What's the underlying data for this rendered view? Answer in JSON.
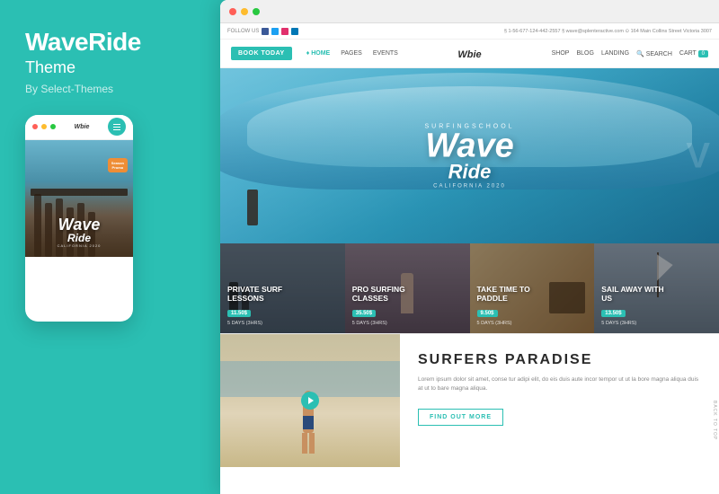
{
  "brand": {
    "title": "WaveRide",
    "subtitle": "Theme",
    "by": "By Select-Themes"
  },
  "mobile": {
    "dot_colors": [
      "#ff5f57",
      "#febc2e",
      "#28c840"
    ],
    "logo": "Wbie",
    "wave_text": "Wave",
    "ride_text": "Ride",
    "sub_text": "CALIFORNIA 2020",
    "badges": [
      "Season\nPromo"
    ]
  },
  "browser": {
    "dot_colors": [
      "#ff5f57",
      "#febc2e",
      "#28c840"
    ]
  },
  "site": {
    "topbar": {
      "follow_label": "FOLLOW US",
      "contact": "§ 1-56-677-124-442-2557  § wave@splenteractive.com  ⊙ 164 Main Collins Street Victoria 3007"
    },
    "nav": {
      "book_button": "BOOK TODAY",
      "links": [
        "♦ HOME",
        "PAGES",
        "EVENTS"
      ],
      "logo": "Wbie",
      "right_links": [
        "SHOP",
        "BLOG",
        "LANDING"
      ],
      "search": "SEARCH",
      "cart": "CART (0)",
      "cart_badge": "0"
    },
    "hero": {
      "school_text": "SURFINGSCHOOL",
      "wave_text": "Wave",
      "ride_text": "Ride",
      "california": "CALIFORNIA 2020"
    },
    "cards": [
      {
        "title": "PRIVATE SURF\nLESSONS",
        "badge": "11.50$",
        "days": "5 DAYS (3HRS)",
        "bg": "surf"
      },
      {
        "title": "PRO SURFING\nCLASSES",
        "badge": "35.50$",
        "days": "5 DAYS (3HRS)",
        "bg": "pro"
      },
      {
        "title": "TAKE TIME TO\nPADDLE",
        "badge": "9.50$",
        "days": "5 DAYS (3HRS)",
        "bg": "paddle"
      },
      {
        "title": "SAIL AWAY WITH\nUS",
        "badge": "13.50$",
        "days": "5 DAYS (3HRS)",
        "bg": "sail"
      }
    ],
    "lower": {
      "title": "SURFERS PARADISE",
      "text": "Lorem ipsum dolor sit amet, conse tur adipi elit, do eis duis aute incor tempor ut ut la bore magna aliqua duis at ut to bare magna aliqua.",
      "find_out_btn": "FIND OUT MORE"
    },
    "back_to_top": "BACK TO TOP"
  },
  "colors": {
    "teal": "#2bbfb3",
    "white": "#ffffff",
    "dark": "#2a2a2a"
  }
}
